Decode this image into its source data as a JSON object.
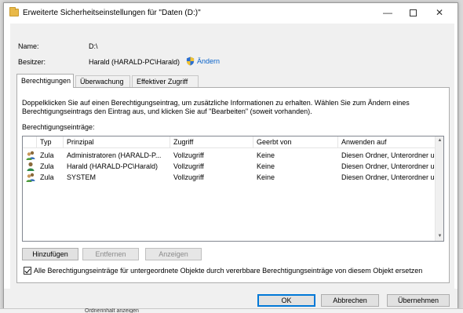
{
  "window": {
    "title": "Erweiterte Sicherheitseinstellungen für \"Daten (D:)\"",
    "controls": {
      "minimize": "—",
      "close": "✕"
    }
  },
  "fields": {
    "name_label": "Name:",
    "name_value": "D:\\",
    "owner_label": "Besitzer:",
    "owner_value": "Harald (HARALD-PC\\Harald)",
    "change_link": "Ändern"
  },
  "tabs": [
    {
      "label": "Berechtigungen",
      "active": true
    },
    {
      "label": "Überwachung",
      "active": false
    },
    {
      "label": "Effektiver Zugriff",
      "active": false
    }
  ],
  "info_text": "Doppelklicken Sie auf einen Berechtigungseintrag, um zusätzliche Informationen zu erhalten. Wählen Sie zum Ändern eines Berechtigungseintrags den Eintrag aus, und klicken Sie auf \"Bearbeiten\" (soweit vorhanden).",
  "entries_label": "Berechtigungseinträge:",
  "table": {
    "headers": [
      "Typ",
      "Prinzipal",
      "Zugriff",
      "Geerbt von",
      "Anwenden auf"
    ],
    "rows": [
      {
        "icon": "group-users-icon",
        "type": "Zulas...",
        "principal": "Administratoren (HARALD-P...",
        "access": "Vollzugriff",
        "inherited": "Keine",
        "applies": "Diesen Ordner, Unterordner un..."
      },
      {
        "icon": "user-icon",
        "type": "Zulas...",
        "principal": "Harald (HARALD-PC\\Harald)",
        "access": "Vollzugriff",
        "inherited": "Keine",
        "applies": "Diesen Ordner, Unterordner un..."
      },
      {
        "icon": "group-users-icon",
        "type": "Zulas...",
        "principal": "SYSTEM",
        "access": "Vollzugriff",
        "inherited": "Keine",
        "applies": "Diesen Ordner, Unterordner un..."
      }
    ]
  },
  "buttons": {
    "add": "Hinzufügen",
    "remove": "Entfernen",
    "view": "Anzeigen",
    "ok": "OK",
    "cancel": "Abbrechen",
    "apply": "Übernehmen"
  },
  "replace_checkbox": {
    "checked": true,
    "label": "Alle Berechtigungseinträge für untergeordnete Objekte durch vererbbare Berechtigungseinträge von diesem Objekt ersetzen"
  },
  "background_fragment": "Ordnerinhalt anzeigen",
  "colors": {
    "link": "#0a63c9",
    "accent": "#0078d7",
    "folder": "#e9b949"
  }
}
